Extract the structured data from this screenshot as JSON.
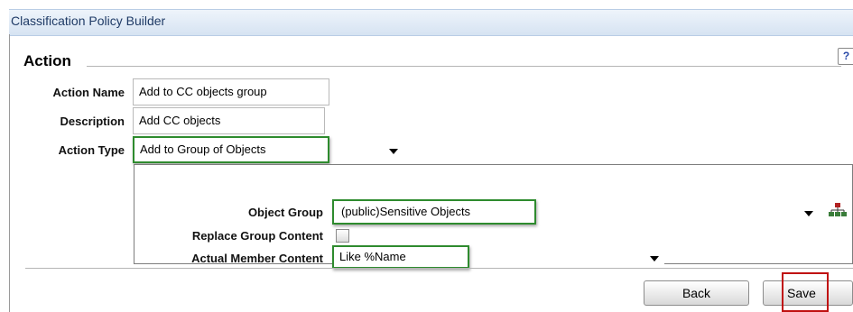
{
  "window": {
    "title": "Classification Policy Builder"
  },
  "section": {
    "title": "Action",
    "help_icon": "?"
  },
  "form": {
    "action_name_label": "Action Name",
    "action_name_value": "Add to CC objects group",
    "description_label": "Description",
    "description_value": "Add CC objects",
    "action_type_label": "Action Type",
    "action_type_value": "Add to Group of Objects"
  },
  "group": {
    "object_group_label": "Object Group",
    "object_group_value": "(public)Sensitive Objects",
    "replace_label": "Replace Group Content",
    "replace_checked": false,
    "member_content_label": "Actual Member Content",
    "member_content_value": "Like %Name"
  },
  "buttons": {
    "back": "Back",
    "save": "Save"
  },
  "colors": {
    "highlight_green": "#2e8b2e",
    "highlight_red": "#c01010",
    "title_text": "#1f3b66"
  }
}
